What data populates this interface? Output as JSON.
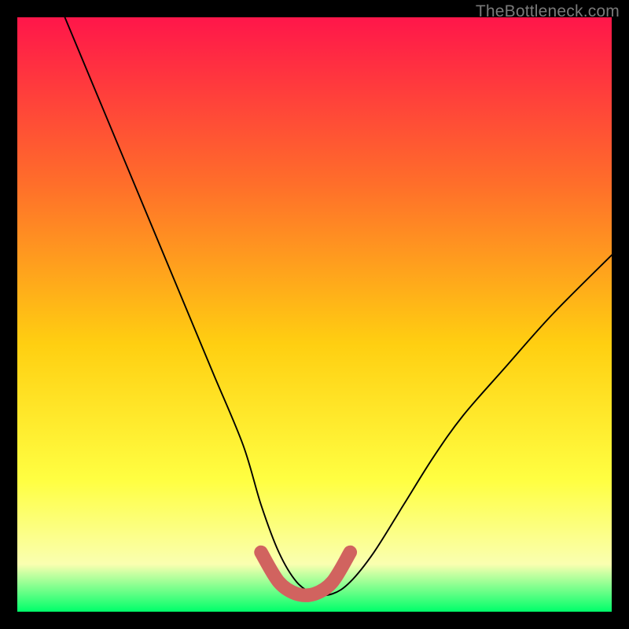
{
  "watermark": "TheBottleneck.com",
  "colors": {
    "frame": "#000000",
    "gradient_top": "#ff164a",
    "gradient_q1": "#ff6e2a",
    "gradient_mid": "#ffcf11",
    "gradient_q3": "#ffff42",
    "gradient_near_bottom": "#faffb0",
    "gradient_bottom": "#00ff6a",
    "curve": "#000000",
    "knee": "#d1635f"
  },
  "chart_data": {
    "type": "line",
    "title": "",
    "xlabel": "",
    "ylabel": "",
    "xlim": [
      0,
      100
    ],
    "ylim": [
      0,
      100
    ],
    "grid": false,
    "series": [
      {
        "name": "bottleneck-curve",
        "x": [
          8,
          13,
          18,
          23,
          28,
          33,
          38,
          41,
          44,
          47,
          50,
          53,
          56,
          60,
          65,
          70,
          75,
          82,
          90,
          100
        ],
        "y": [
          100,
          88,
          76,
          64,
          52,
          40,
          28,
          18,
          10,
          5,
          3,
          3,
          5,
          10,
          18,
          26,
          33,
          41,
          50,
          60
        ]
      },
      {
        "name": "knee-highlight",
        "x": [
          41,
          44,
          47,
          50,
          53,
          56
        ],
        "y": [
          10,
          5,
          3,
          3,
          5,
          10
        ]
      }
    ]
  }
}
